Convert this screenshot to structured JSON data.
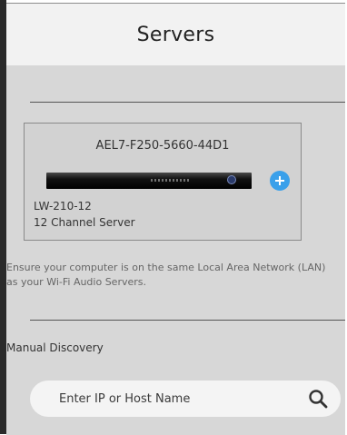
{
  "header": {
    "title": "Servers"
  },
  "server_card": {
    "device_id": "AEL7-F250-5660-44D1",
    "model": "LW-210-12",
    "type": "12 Channel Server",
    "add_icon": "plus-circle-icon",
    "accent_color": "#3aa0ea"
  },
  "info": {
    "note": "Ensure your computer is on the same Local Area Network (LAN) as your Wi-Fi Audio Servers."
  },
  "manual_discovery": {
    "label": "Manual Discovery",
    "placeholder": "Enter IP or Host Name",
    "value": "",
    "search_icon": "search-icon"
  }
}
